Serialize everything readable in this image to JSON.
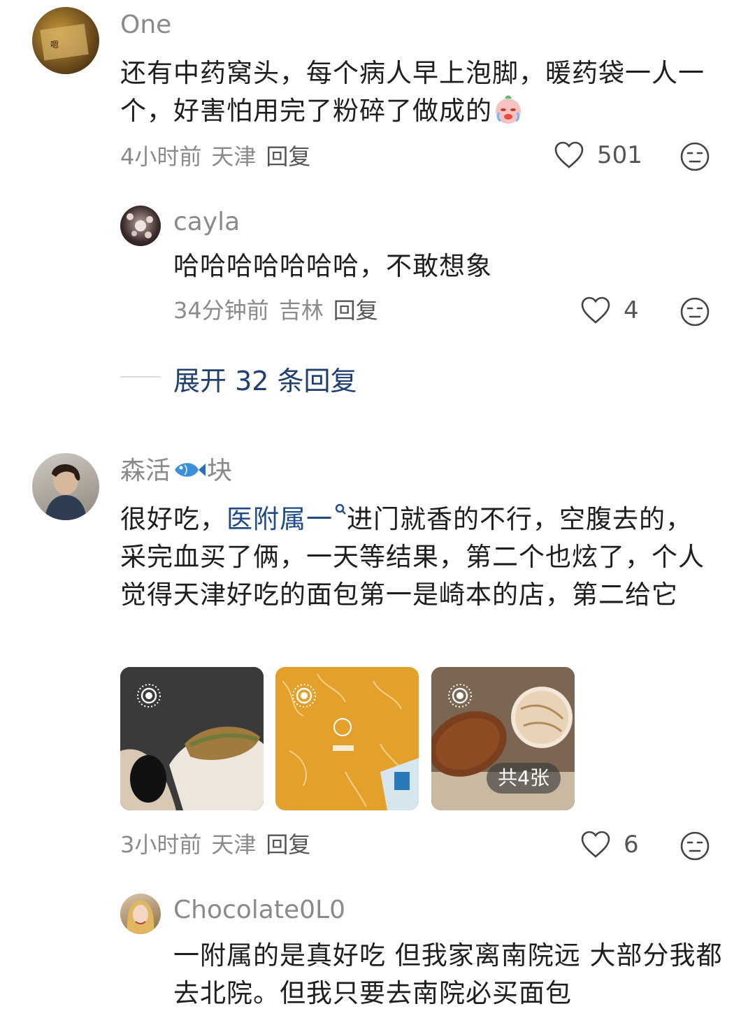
{
  "comments": [
    {
      "author": "One",
      "text": "还有中药窝头，每个病人早上泡脚，暖药袋一人一个，好害怕用完了粉碎了做成的",
      "time": "4小时前",
      "location": "天津",
      "reply_label": "回复",
      "likes": "501",
      "replies": [
        {
          "author": "cayla",
          "text": "哈哈哈哈哈哈哈，不敢想象",
          "time": "34分钟前",
          "location": "吉林",
          "reply_label": "回复",
          "likes": "4"
        }
      ],
      "expand_label": "展开 32 条回复"
    },
    {
      "author_part1": "森活",
      "author_part2": "块",
      "text_part1": "很好吃，",
      "link_text": "医附属一",
      "text_part2": "进门就香的不行，空腹去的，采完血买了俩，一天等结果，第二个也炫了，个人觉得天津好吃的面包第一是崎本的店，第二给它",
      "image_count_label": "共4张",
      "time": "3小时前",
      "location": "天津",
      "reply_label": "回复",
      "likes": "6",
      "replies": [
        {
          "author": "Chocolate0L0",
          "text": "一附属的是真好吃 但我家离南院远 大部分我都去北院。但我只要去南院必买面包"
        }
      ]
    }
  ],
  "icons": {
    "like": "heart-outline-icon",
    "dislike": "meh-face-icon",
    "live_photo": "live-photo-icon",
    "search": "search-icon"
  },
  "colors": {
    "text": "#1e1e1e",
    "meta": "#8a8a8a",
    "link": "#1f4a8a",
    "expand": "#1f3f6e"
  }
}
